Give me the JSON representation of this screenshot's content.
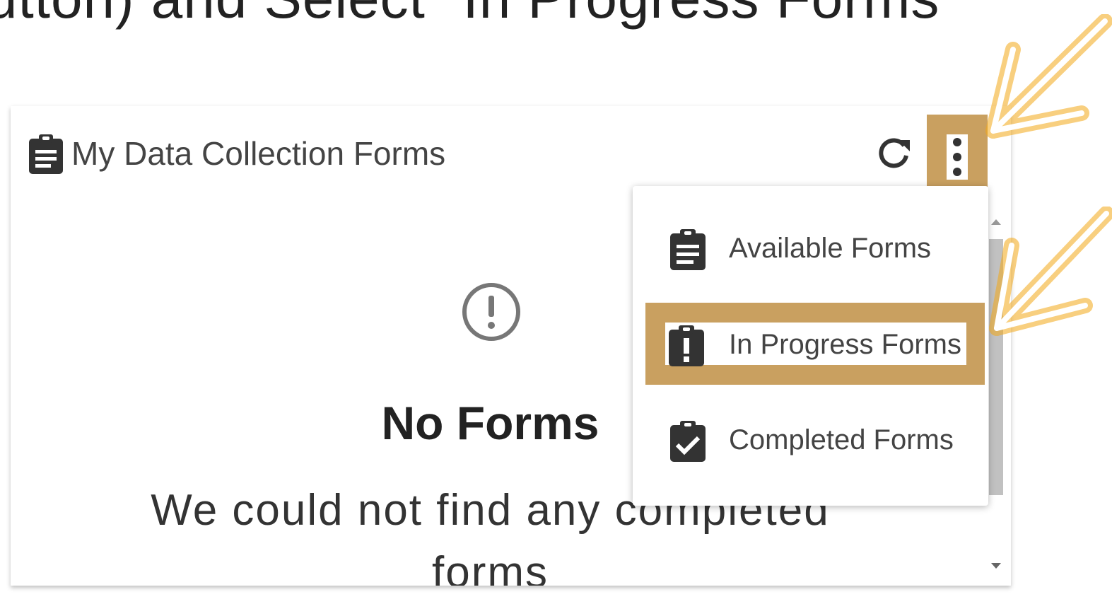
{
  "instruction_text": "utton) and Select \"In Progress Forms\"",
  "card": {
    "title": "My Data Collection Forms",
    "title_icon": "clipboard-icon",
    "refresh_icon": "refresh-icon",
    "more_icon": "more-vert-icon"
  },
  "empty_state": {
    "icon": "alert-circle-icon",
    "title": "No Forms",
    "message": "We could not find any completed forms"
  },
  "menu": {
    "items": [
      {
        "label": "Available Forms",
        "icon": "clipboard-list-icon"
      },
      {
        "label": "In Progress Forms",
        "icon": "clipboard-alert-icon"
      },
      {
        "label": "Completed Forms",
        "icon": "clipboard-check-icon"
      }
    ]
  },
  "colors": {
    "highlight": "#c9a060",
    "arrow": "#f3a818",
    "icon": "#333333"
  }
}
